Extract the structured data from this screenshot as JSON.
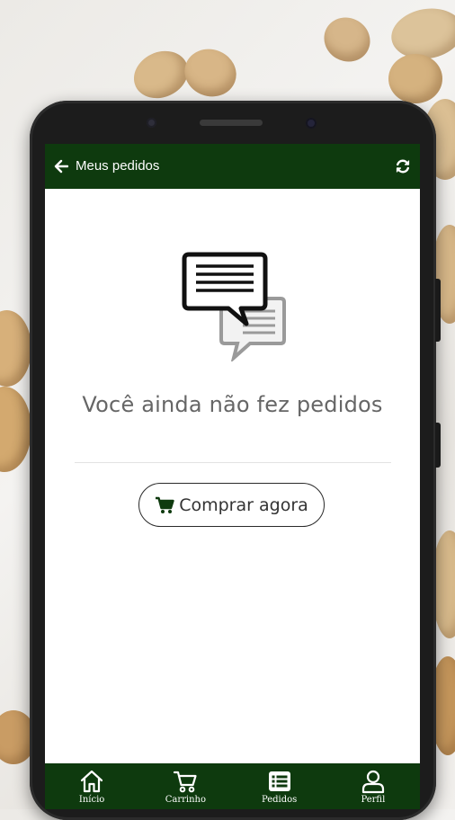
{
  "header": {
    "title": "Meus pedidos",
    "back_icon": "arrow-left-icon",
    "refresh_icon": "refresh-icon"
  },
  "empty_state": {
    "icon": "chat-bubbles-icon",
    "message": "Você ainda não fez pedidos"
  },
  "action": {
    "icon": "shopping-cart-icon",
    "label": "Comprar agora"
  },
  "bottom_nav": {
    "items": [
      {
        "label": "Início",
        "icon": "home-icon"
      },
      {
        "label": "Carrinho",
        "icon": "cart-icon"
      },
      {
        "label": "Pedidos",
        "icon": "list-icon"
      },
      {
        "label": "Perfil",
        "icon": "user-icon"
      }
    ]
  },
  "colors": {
    "primary": "#0e3a0e",
    "text_muted": "#666666",
    "background": "#ffffff"
  }
}
